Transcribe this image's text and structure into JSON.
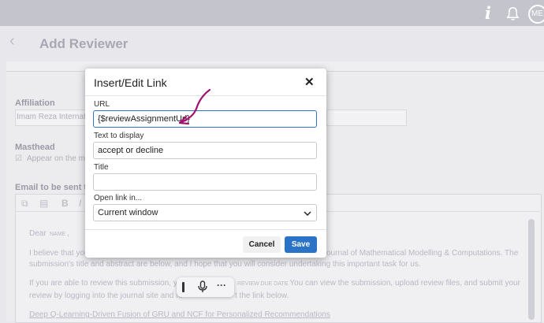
{
  "topbar": {
    "info_glyph": "i",
    "avatar_initials": "ME"
  },
  "page": {
    "title": "Add Reviewer",
    "back_glyph": "‹"
  },
  "background": {
    "affiliation_label": "Affiliation",
    "affiliation_value": "Imam Reza Internati",
    "masthead_label": "Masthead",
    "masthead_option": "Appear on the ma",
    "email_label": "Email to be sent t",
    "dear_line": "Dear",
    "name_tag": "NAME",
    "comma": ",",
    "para1_left": "I believe that you",
    "para1_right": "ournal of Mathematical Modelling & Computations. The",
    "para1_line2": "submission's title and abstract are below, and I hope that you will consider undertaking this important task for us.",
    "para2_left": "If you are able to review this submission, you",
    "para2_tag": "REVIEW DUE DATE",
    "para2_right": ". You can view the submission, upload review files, and submit your",
    "para2_line2_left": "review by logging into the journal site and fo",
    "para2_line2_right": "t the link below.",
    "link_text": "Deep Q-Learning-Driven Fusion of GRU and NCF for Personalized Recommendations"
  },
  "dialog": {
    "title": "Insert/Edit Link",
    "close_glyph": "✕",
    "url_label": "URL",
    "url_value": "{$reviewAssignmentUrl}",
    "text_label": "Text to display",
    "text_value": "accept or decline",
    "title_label": "Title",
    "title_value": "",
    "open_label": "Open link in...",
    "open_value": "Current window",
    "cancel_label": "Cancel",
    "save_label": "Save"
  },
  "float_toolbar": {
    "more_glyph": "···"
  },
  "colors": {
    "accent": "#2a73c6",
    "annotation": "#a0126e"
  }
}
